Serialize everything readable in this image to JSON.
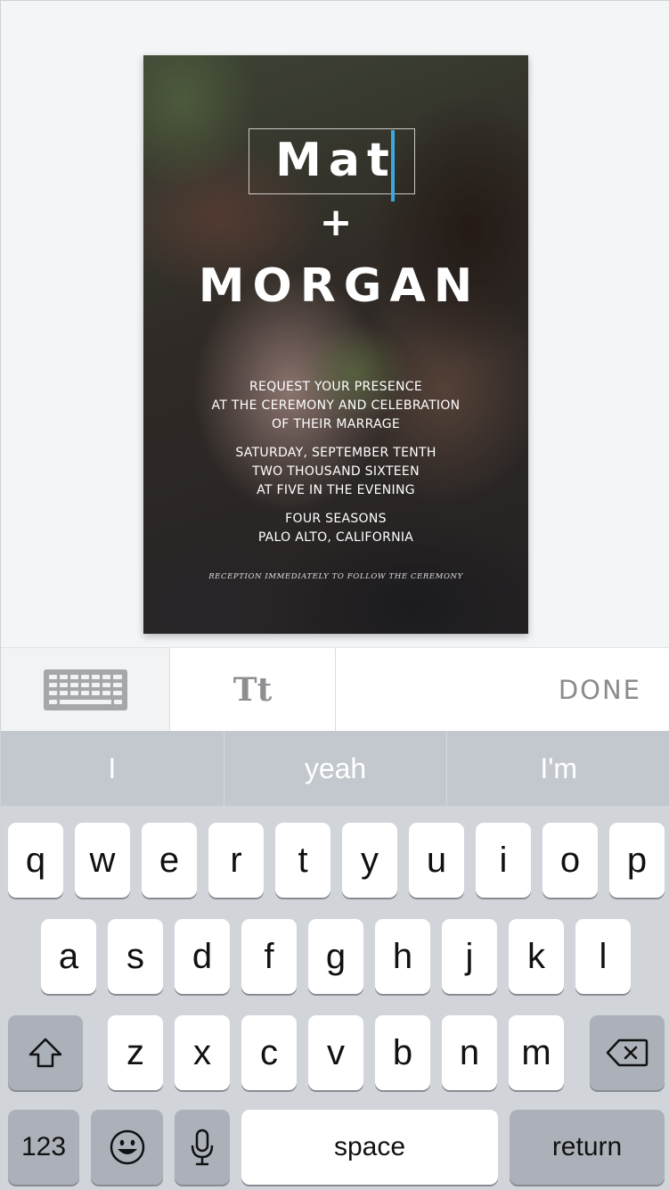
{
  "invitation": {
    "name1": "Mat",
    "plus": "+",
    "name2": "MORGAN",
    "details1": [
      "REQUEST YOUR PRESENCE",
      "AT THE CEREMONY AND CELEBRATION",
      "OF THEIR MARRAGE"
    ],
    "details2": [
      "SATURDAY, SEPTEMBER TENTH",
      "TWO THOUSAND SIXTEEN",
      "AT FIVE IN THE EVENING"
    ],
    "details3": [
      "FOUR SEASONS",
      "PALO ALTO, CALIFORNIA"
    ],
    "footnote": "RECEPTION IMMEDIATELY TO FOLLOW THE CEREMONY"
  },
  "toolbar": {
    "keyboard_icon": "keyboard-icon",
    "text_style_label": "Tt",
    "done_label": "DONE"
  },
  "keyboard": {
    "suggestions": [
      "I",
      "yeah",
      "I'm"
    ],
    "row1": [
      "q",
      "w",
      "e",
      "r",
      "t",
      "y",
      "u",
      "i",
      "o",
      "p"
    ],
    "row2": [
      "a",
      "s",
      "d",
      "f",
      "g",
      "h",
      "j",
      "k",
      "l"
    ],
    "row3": [
      "z",
      "x",
      "c",
      "v",
      "b",
      "n",
      "m"
    ],
    "numbers_label": "123",
    "space_label": "space",
    "return_label": "return",
    "icons": {
      "shift": "shift-icon",
      "delete": "backspace-icon",
      "emoji": "emoji-icon",
      "mic": "microphone-icon"
    }
  },
  "colors": {
    "caret": "#3aa9e0",
    "keyboard_bg": "#d1d4d9",
    "special_key": "#abb0b9"
  }
}
